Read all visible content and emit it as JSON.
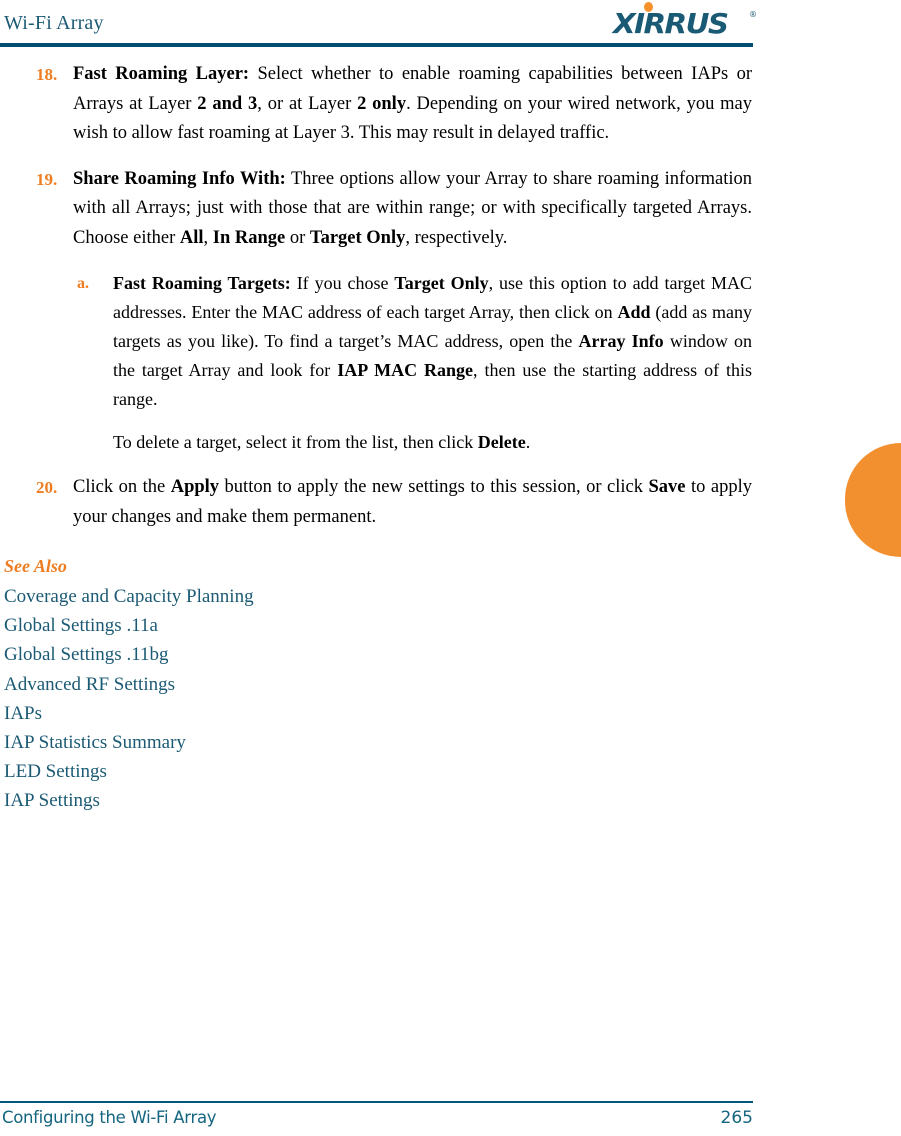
{
  "header": {
    "title": "Wi-Fi Array",
    "logo_word": "XIRRUS",
    "logo_registered": "®",
    "rule_color": "#004f70",
    "title_color": "#1b5a74"
  },
  "accent": {
    "orange": "#ee7d22",
    "teal": "#1b5a74",
    "tab_orange": "#f2902f"
  },
  "content": {
    "items": [
      {
        "marker": "18.",
        "runs": [
          {
            "text": "Fast Roaming Layer:",
            "bold": true
          },
          {
            "text": " Select whether to enable roaming capabilities between IAPs or Arrays at Layer ",
            "bold": false
          },
          {
            "text": "2 and 3",
            "bold": true
          },
          {
            "text": ", or at Layer ",
            "bold": false
          },
          {
            "text": "2 only",
            "bold": true
          },
          {
            "text": ". Depending on your wired network, you may wish to allow fast roaming at Layer 3. This may result in delayed traffic.",
            "bold": false
          }
        ]
      },
      {
        "marker": "19.",
        "runs": [
          {
            "text": "Share Roaming Info With:",
            "bold": true
          },
          {
            "text": " Three options allow your Array to share roaming information with all Arrays; just with those that are within range; or with specifically targeted Arrays. Choose either ",
            "bold": false
          },
          {
            "text": "All",
            "bold": true
          },
          {
            "text": ", ",
            "bold": false
          },
          {
            "text": "In Range",
            "bold": true
          },
          {
            "text": " or ",
            "bold": false
          },
          {
            "text": "Target Only",
            "bold": true
          },
          {
            "text": ", respectively.",
            "bold": false
          }
        ]
      }
    ],
    "sub_item": {
      "marker": "a.",
      "runs": [
        {
          "text": "Fast Roaming Targets:",
          "bold": true
        },
        {
          "text": " If you chose ",
          "bold": false
        },
        {
          "text": "Target Only",
          "bold": true
        },
        {
          "text": ", use this option to add target MAC addresses. Enter the MAC address of each target Array, then click on ",
          "bold": false
        },
        {
          "text": "Add",
          "bold": true
        },
        {
          "text": " (add as many targets as you like). To find a target’s MAC address, open the ",
          "bold": false
        },
        {
          "text": "Array Info",
          "bold": true
        },
        {
          "text": " window on the target Array and look for ",
          "bold": false
        },
        {
          "text": "IAP MAC Range",
          "bold": true
        },
        {
          "text": ", then use the starting address of this range.",
          "bold": false
        }
      ]
    },
    "sub_paragraph": {
      "runs": [
        {
          "text": "To delete a target, select it from the list, then click ",
          "bold": false
        },
        {
          "text": "Delete",
          "bold": true
        },
        {
          "text": ".",
          "bold": false
        }
      ]
    },
    "final_item": {
      "marker": "20.",
      "runs": [
        {
          "text": "Click on the ",
          "bold": false
        },
        {
          "text": "Apply",
          "bold": true
        },
        {
          "text": " button to apply the new settings to this session, or click ",
          "bold": false
        },
        {
          "text": "Save",
          "bold": true
        },
        {
          "text": " to apply your changes and make them permanent.",
          "bold": false
        }
      ]
    }
  },
  "see_also": {
    "heading": "See Also",
    "links": [
      "Coverage and Capacity Planning",
      "Global Settings .11a",
      "Global Settings .11bg",
      "Advanced RF Settings",
      "IAPs",
      "IAP Statistics Summary",
      "LED Settings",
      "IAP Settings"
    ]
  },
  "footer": {
    "text": "Configuring the Wi-Fi Array",
    "page_number": "265"
  }
}
